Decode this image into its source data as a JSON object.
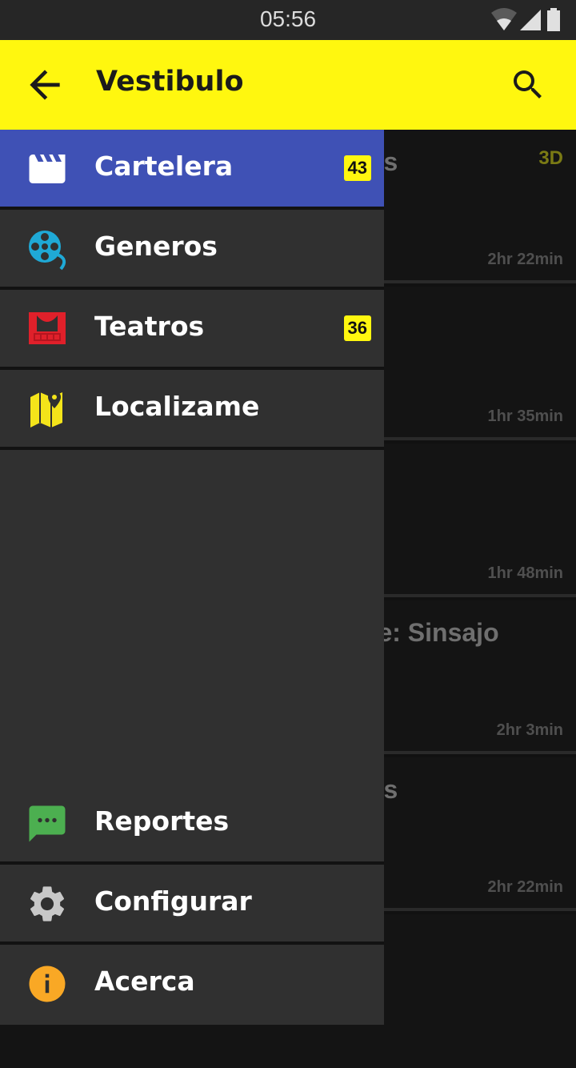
{
  "status_bar": {
    "time": "05:56",
    "icons": [
      "wifi-icon",
      "cell-signal-icon",
      "battery-icon"
    ]
  },
  "app_bar": {
    "title": "Vestibulo",
    "back_icon": "arrow-back-icon",
    "search_icon": "search-icon",
    "color": "#fff70f"
  },
  "drawer": {
    "items": [
      {
        "label": "Cartelera",
        "icon": "clapperboard-icon",
        "badge": "43",
        "active": true
      },
      {
        "label": "Generos",
        "icon": "film-reel-icon",
        "badge": ""
      },
      {
        "label": "Teatros",
        "icon": "theater-icon",
        "badge": "36"
      },
      {
        "label": "Localizame",
        "icon": "map-pin-icon",
        "badge": ""
      }
    ],
    "footer_items": [
      {
        "label": "Reportes",
        "icon": "message-icon"
      },
      {
        "label": "Configurar",
        "icon": "gear-icon"
      },
      {
        "label": "Acerca",
        "icon": "info-icon"
      }
    ],
    "active_color": "#3f51b5"
  },
  "movies": [
    {
      "title_fragment": "gs",
      "tag": "3D",
      "duration": "2hr 22min"
    },
    {
      "title_fragment": "",
      "tag": "",
      "duration": "1hr 35min"
    },
    {
      "title_fragment": "",
      "tag": "",
      "duration": "1hr 48min"
    },
    {
      "title_fragment": "re: Sinsajo",
      "tag": "",
      "duration": "2hr 3min"
    },
    {
      "title_fragment": "gs",
      "tag": "",
      "duration": "2hr 22min"
    }
  ]
}
